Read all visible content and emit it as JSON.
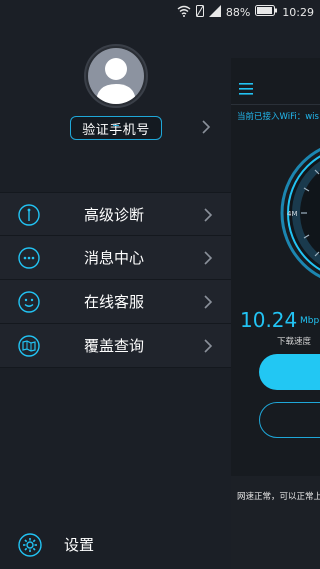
{
  "status_bar": {
    "battery_percent": "88%",
    "time": "10:29",
    "icons": [
      "wifi-signal-icon",
      "no-sim-icon",
      "cell-signal-icon",
      "battery-icon"
    ]
  },
  "drawer": {
    "profile": {
      "avatar_icon": "default-user-avatar",
      "verify_button_label": "验证手机号"
    },
    "menu_items": [
      {
        "label": "高级诊断",
        "icon": "diagnostic-icon"
      },
      {
        "label": "消息中心",
        "icon": "message-icon"
      },
      {
        "label": "在线客服",
        "icon": "customer-service-icon"
      },
      {
        "label": "覆盖查询",
        "icon": "coverage-map-icon"
      }
    ],
    "settings": {
      "label": "设置",
      "icon": "gear-icon"
    }
  },
  "main_app": {
    "wifi_status": "当前已接入WiFi：wis",
    "gauge_tick_label": "4M",
    "speed_value": "10.24",
    "speed_unit": "Mbp",
    "speed_label": "下载速度",
    "network_status": "网速正常，可以正常上"
  },
  "colors": {
    "accent": "#22c3f3",
    "drawer_bg": "#1b1f26",
    "menu_bg": "#20242c"
  }
}
